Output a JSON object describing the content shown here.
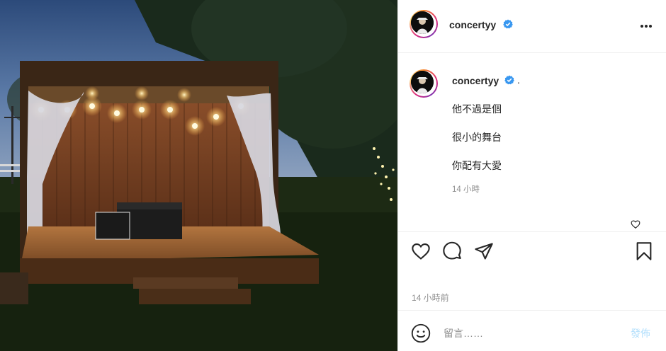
{
  "photo": {
    "alt_icon": "stage-photo"
  },
  "header": {
    "username": "concertyy",
    "verified_icon": "verified-badge-icon",
    "more_icon": "more-options-icon"
  },
  "caption": {
    "username": "concertyy",
    "dot": ".",
    "lines": [
      "他不過是個",
      "很小的舞台",
      "你配有大愛"
    ],
    "time": "14 小時"
  },
  "actions": {
    "like_icon": "heart-icon",
    "comment_icon": "comment-icon",
    "share_icon": "share-icon",
    "save_icon": "bookmark-icon"
  },
  "post_time": "14 小時前",
  "comment_box": {
    "placeholder": "留言……",
    "post_label": "發佈"
  },
  "colors": {
    "verified": "#3897f0",
    "post_disabled": "#b2dffc",
    "muted": "#8e8e8e"
  }
}
